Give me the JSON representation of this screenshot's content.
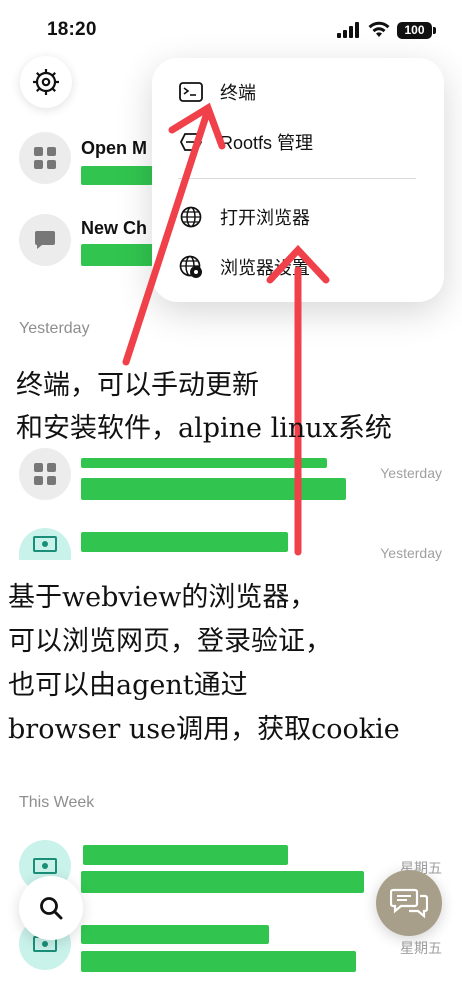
{
  "status_bar": {
    "time": "18:20",
    "battery": "100"
  },
  "icons": {
    "settings": "gear-icon",
    "terminal": "terminal-icon",
    "rootfs": "rootfs-icon",
    "browser_open": "globe-icon",
    "browser_settings": "globe-gear-icon",
    "search": "search-icon",
    "new_chat": "chat-bubbles-icon"
  },
  "colors": {
    "redaction": "#31c54f",
    "annotation_arrow": "#f0404a",
    "chat_fab": "#a79f89"
  },
  "menu": {
    "items": [
      {
        "label": "终端"
      },
      {
        "label": "Rootfs 管理"
      },
      {
        "label": "打开浏览器"
      },
      {
        "label": "浏览器设置"
      }
    ]
  },
  "conversations": {
    "top": [
      {
        "title": "Open M"
      },
      {
        "title": "New Ch"
      }
    ],
    "sections": [
      {
        "header": "Yesterday",
        "times": [
          "Yesterday",
          "Yesterday"
        ]
      },
      {
        "header": "This Week",
        "times": [
          "星期五",
          "星期五"
        ]
      }
    ]
  },
  "annotations": {
    "terminal_note": [
      "终端，可以手动更新",
      "和安装软件，alpine linux系统"
    ],
    "browser_note": [
      "基于webview的浏览器，",
      "可以浏览网页，登录验证，",
      "也可以由agent通过",
      "browser use调用，获取cookie"
    ]
  }
}
